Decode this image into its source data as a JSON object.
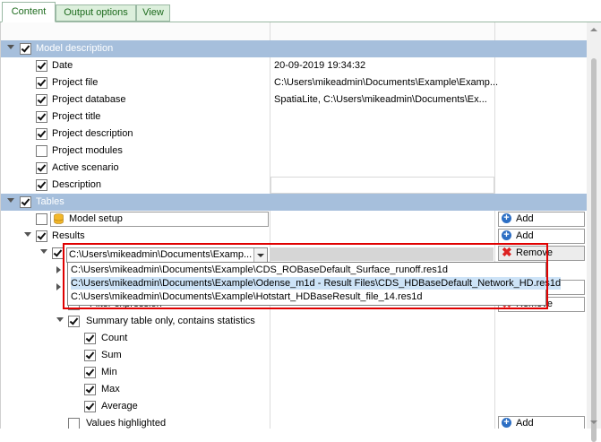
{
  "tabs": [
    {
      "label": "Content",
      "active": true
    },
    {
      "label": "Output options",
      "active": false
    },
    {
      "label": "View",
      "active": false
    }
  ],
  "rows": {
    "model_description": "Model description",
    "date": {
      "label": "Date",
      "value": "20-09-2019 19:34:32"
    },
    "project_file": {
      "label": "Project file",
      "value": "C:\\Users\\mikeadmin\\Documents\\Example\\Examp..."
    },
    "project_database": {
      "label": "Project database",
      "value": "SpatiaLite, C:\\Users\\mikeadmin\\Documents\\Ex..."
    },
    "project_title": {
      "label": "Project title"
    },
    "project_description": {
      "label": "Project description"
    },
    "project_modules": {
      "label": "Project modules"
    },
    "active_scenario": {
      "label": "Active scenario"
    },
    "description": {
      "label": "Description"
    },
    "tables": "Tables",
    "model_setup": "Model setup",
    "results": "Results",
    "result_file": "C:\\Users\\mikeadmin\\Documents\\Examp...",
    "filter_expression": "Filter expression",
    "summary_table": "Summary table only, contains statistics",
    "count": "Count",
    "sum": "Sum",
    "min": "Min",
    "max": "Max",
    "average": "Average",
    "values_highlighted": "Values highlighted"
  },
  "buttons": {
    "add": "Add",
    "remove": "Remove"
  },
  "dropdown_options": [
    "C:\\Users\\mikeadmin\\Documents\\Example\\CDS_ROBaseDefault_Surface_runoff.res1d",
    "C:\\Users\\mikeadmin\\Documents\\Example\\Odense_m1d - Result Files\\CDS_HDBaseDefault_Network_HD.res1d",
    "C:\\Users\\mikeadmin\\Documents\\Example\\Hotstart_HDBaseResult_file_14.res1d"
  ],
  "colors": {
    "group_header_bg": "#a6bfdc",
    "tab_text": "#1d6b1d",
    "highlight_border": "#e00000",
    "add_icon": "#2d6fc4"
  }
}
